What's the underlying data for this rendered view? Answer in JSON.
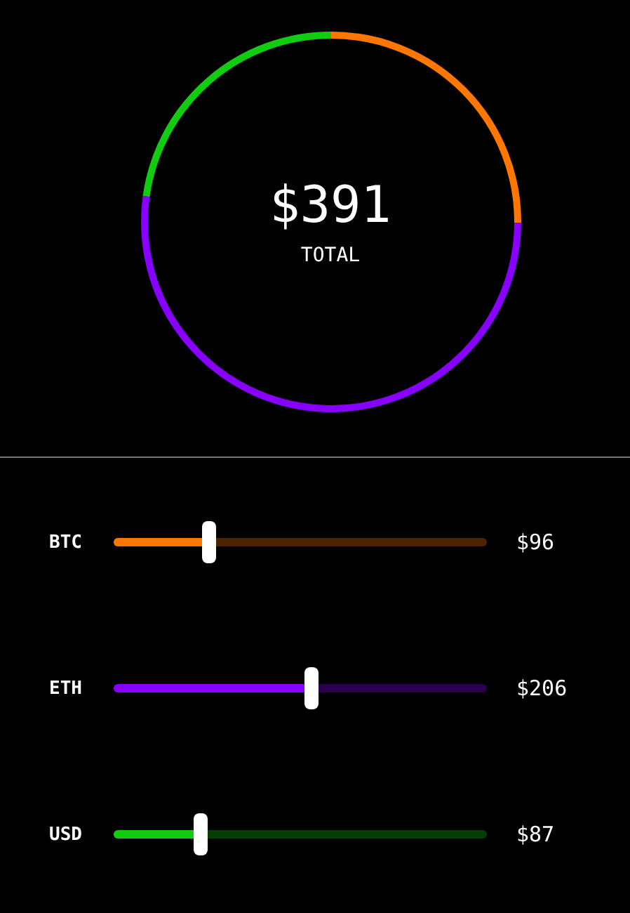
{
  "total": {
    "amount": "$391",
    "label": "TOTAL"
  },
  "assets": [
    {
      "symbol": "BTC",
      "color": "#ff7700",
      "level": 0.255,
      "value": "$96"
    },
    {
      "symbol": "ETH",
      "color": "#8800ff",
      "level": 0.53,
      "value": "$206"
    },
    {
      "symbol": "USD",
      "color": "#11cc11",
      "level": 0.232,
      "value": "$87"
    }
  ]
}
